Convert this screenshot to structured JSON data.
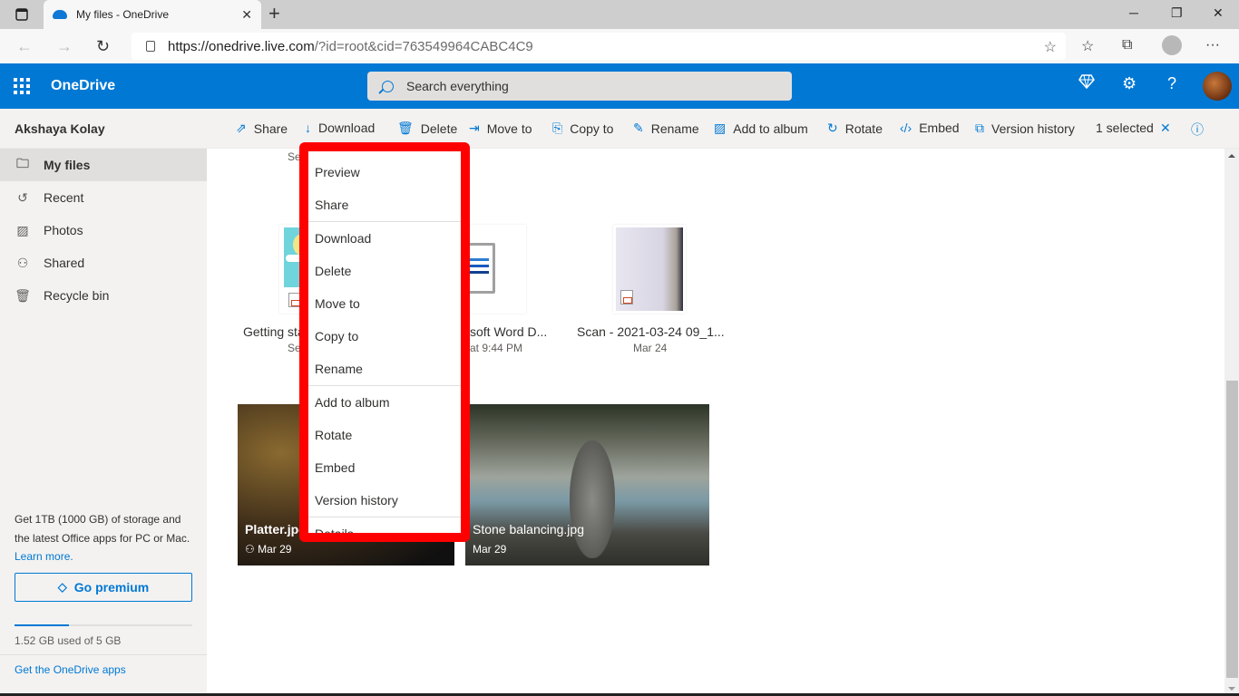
{
  "browser": {
    "tab_title": "My files - OneDrive",
    "url_host": "https://onedrive.live.com",
    "url_path": "/?id=root&cid=763549964CABC4C9",
    "icons": [
      "tab-actions-icon",
      "onedrive-favicon",
      "close-tab-icon",
      "new-tab-icon",
      "minimize-icon",
      "restore-icon",
      "window-close-icon",
      "back-icon",
      "forward-icon",
      "refresh-icon",
      "lock-icon",
      "add-favorite-icon",
      "favorites-icon",
      "collections-icon",
      "profile-icon",
      "more-icon"
    ]
  },
  "header": {
    "app_name": "OneDrive",
    "search_placeholder": "Search everything",
    "icons": [
      "app-launcher-icon",
      "premium-diamond-icon",
      "settings-gear-icon",
      "help-icon",
      "user-avatar"
    ]
  },
  "commandbar": {
    "user_name": "Akshaya Kolay",
    "commands": [
      {
        "label": "Share",
        "icon": "share-icon"
      },
      {
        "label": "Download",
        "icon": "download-icon"
      },
      {
        "label": "Delete",
        "icon": "delete-icon"
      },
      {
        "label": "Move to",
        "icon": "move-to-icon"
      },
      {
        "label": "Copy to",
        "icon": "copy-to-icon"
      },
      {
        "label": "Rename",
        "icon": "rename-icon"
      },
      {
        "label": "Add to album",
        "icon": "add-to-album-icon"
      },
      {
        "label": "Rotate",
        "icon": "rotate-icon"
      },
      {
        "label": "Embed",
        "icon": "embed-icon"
      },
      {
        "label": "Version history",
        "icon": "version-history-icon"
      }
    ],
    "selection_text": "1 selected"
  },
  "sidebar": {
    "items": [
      {
        "label": "My files",
        "icon": "folder-icon",
        "active": true
      },
      {
        "label": "Recent",
        "icon": "recent-icon"
      },
      {
        "label": "Photos",
        "icon": "photos-icon"
      },
      {
        "label": "Shared",
        "icon": "shared-icon"
      },
      {
        "label": "Recycle bin",
        "icon": "recycle-bin-icon"
      }
    ],
    "promo_text": "Get 1TB (1000 GB) of storage and the latest Office apps for PC or Mac.",
    "learn_more": "Learn more.",
    "premium_button": "Go premium",
    "storage_used_fraction": 0.304,
    "storage_text": "1.52 GB used of 5 GB",
    "apps_link": "Get the OneDrive apps"
  },
  "files": {
    "top_partial_date": "Se",
    "items": [
      {
        "name": "Getting sta",
        "date": "Se",
        "type": "pptx"
      },
      {
        "name": "soft Word D...",
        "date": "at 9:44 PM",
        "type": "docx"
      },
      {
        "name": "Scan - 2021-03-24 09_1...",
        "date": "Mar 24",
        "type": "pdf"
      }
    ],
    "photos": [
      {
        "name": "Platter.jpg",
        "date": "Mar 29",
        "shared": true
      },
      {
        "name": "Stone balancing.jpg",
        "date": "Mar 29",
        "shared": false
      }
    ]
  },
  "context_menu": {
    "items": [
      "Preview",
      "Share",
      "Download",
      "Delete",
      "Move to",
      "Copy to",
      "Rename",
      "Add to album",
      "Rotate",
      "Embed",
      "Version history",
      "Details"
    ]
  }
}
